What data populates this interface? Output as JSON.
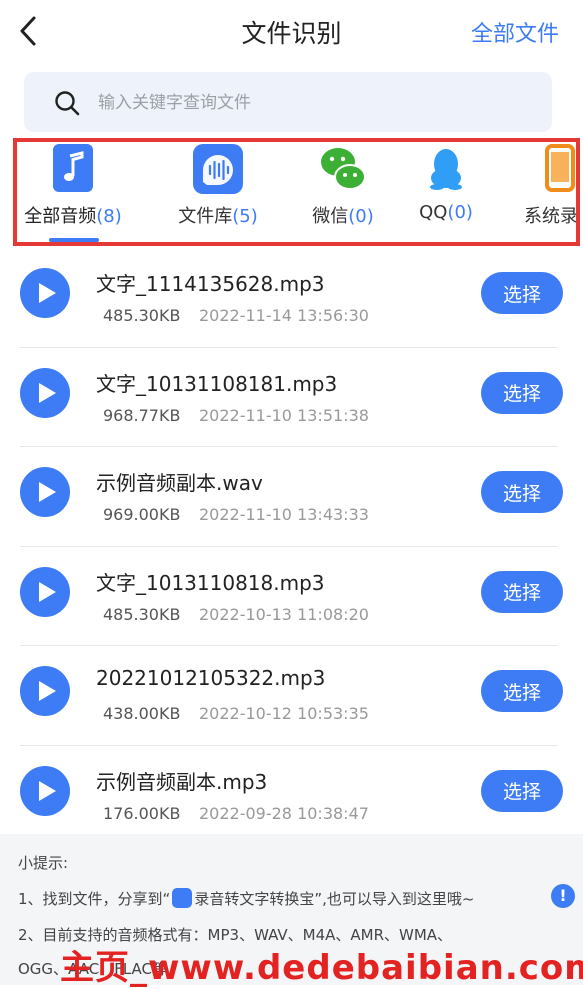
{
  "header": {
    "title": "文件识别",
    "action": "全部文件"
  },
  "search": {
    "placeholder": "输入关键字查询文件"
  },
  "tabs": [
    {
      "label": "全部音频",
      "count": "(8)",
      "icon": "music-note-icon",
      "active": true
    },
    {
      "label": "文件库",
      "count": "(5)",
      "icon": "audio-wave-icon"
    },
    {
      "label": "微信",
      "count": "(0)",
      "icon": "wechat-icon"
    },
    {
      "label": "QQ",
      "count": "(0)",
      "icon": "qq-icon"
    },
    {
      "label": "系统录音",
      "count": "",
      "icon": "phone-icon"
    }
  ],
  "files": [
    {
      "name": "文字_1114135628.mp3",
      "size": "485.30KB",
      "date": "2022-11-14 13:56:30",
      "action": "选择"
    },
    {
      "name": "文字_10131108181.mp3",
      "size": "968.77KB",
      "date": "2022-11-10 13:51:38",
      "action": "选择"
    },
    {
      "name": "示例音频副本.wav",
      "size": "969.00KB",
      "date": "2022-11-10 13:43:33",
      "action": "选择"
    },
    {
      "name": "文字_1013110818.mp3",
      "size": "485.30KB",
      "date": "2022-10-13 11:08:20",
      "action": "选择"
    },
    {
      "name": "20221012105322.mp3",
      "size": "438.00KB",
      "date": "2022-10-12 10:53:35",
      "action": "选择"
    },
    {
      "name": "示例音频副本.mp3",
      "size": "176.00KB",
      "date": "2022-09-28 10:38:47",
      "action": "选择"
    }
  ],
  "tips": {
    "title": "小提示:",
    "line1_a": "1、找到文件，分享到“",
    "line1_b": "录音转文字转换宝”,也可以导入到这里哦~",
    "line2": "2、目前支持的音频格式有：MP3、WAV、M4A、AMR、WMA、",
    "line3": "OGG、AAC、FLAC等"
  },
  "watermark": "主页_www.dedebaibian.com",
  "colors": {
    "accent": "#3d7cf4",
    "highlight_border": "#e53935"
  }
}
